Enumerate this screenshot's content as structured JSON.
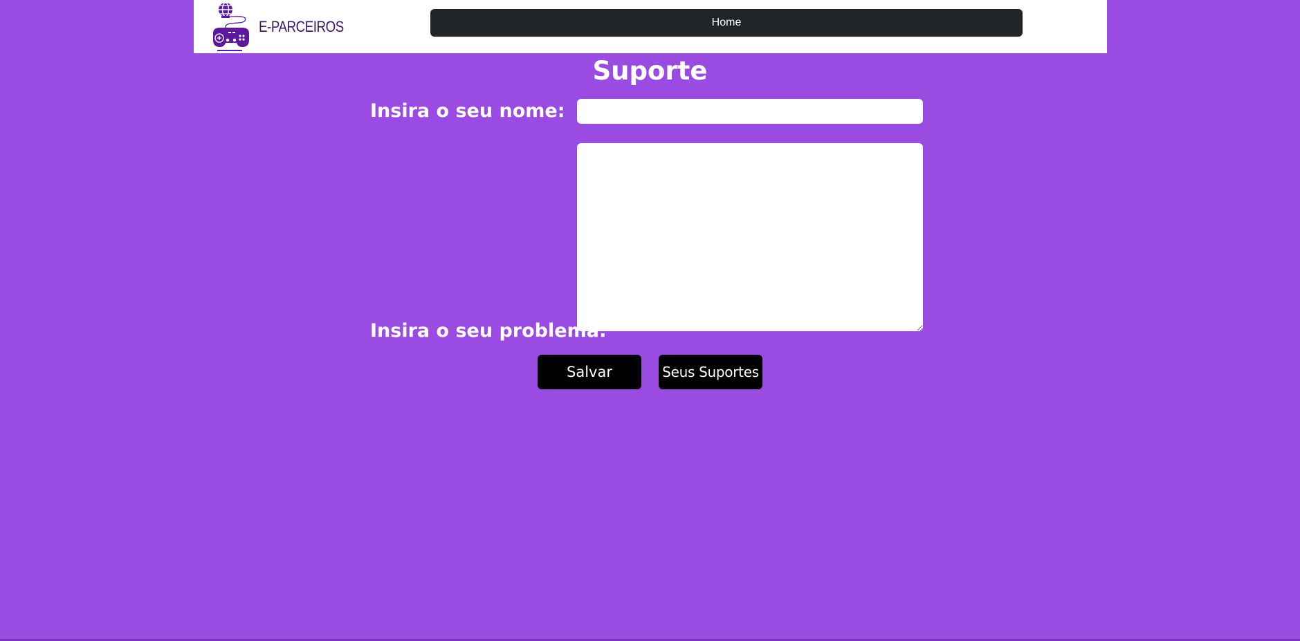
{
  "header": {
    "brand_name": "E-PARCEIROS",
    "logo_icon": "gamepad-globe-logo",
    "nav_home_label": "Home"
  },
  "main": {
    "title": "Suporte",
    "name_label": "Insira o seu nome:",
    "name_value": "",
    "problem_label": "Insira o seu problema:",
    "problem_value": "",
    "save_label": "Salvar",
    "supports_label": "Seus Suportes"
  },
  "colors": {
    "background": "#9a4ce2",
    "header_bg": "#ffffff",
    "nav_button": "#212529",
    "brand": "#3d1466",
    "logo": "#5a1a9a",
    "action_button": "#000000"
  }
}
